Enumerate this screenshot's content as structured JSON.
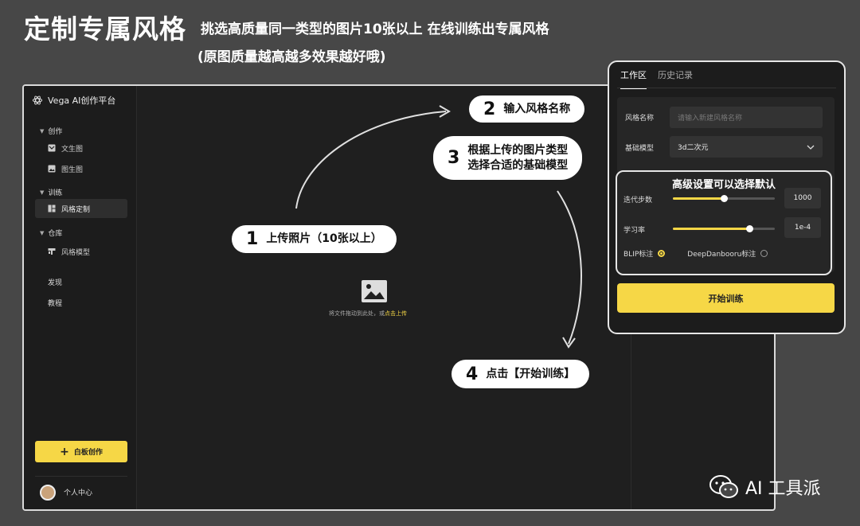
{
  "banner": {
    "title": "定制专属风格",
    "subtitle": "挑选高质量同一类型的图片10张以上 在线训练出专属风格",
    "subtitle2": "(原图质量越高越多效果越好哦)"
  },
  "sidebar": {
    "app_name": "Vega AI创作平台",
    "group_create": "创作",
    "item_text2img": "文生图",
    "item_img2img": "图生图",
    "group_train": "训练",
    "item_style_custom": "风格定制",
    "group_repo": "仓库",
    "item_style_model": "风格模型",
    "discover": "发现",
    "tutorial": "教程",
    "whiteboard_label": "白板创作",
    "user_center": "个人中心"
  },
  "upload": {
    "hint": "将文件拖动到此处，或",
    "link": "点击上传"
  },
  "steps": [
    {
      "num": "1",
      "text": "上传照片（10张以上）"
    },
    {
      "num": "2",
      "text": "输入风格名称"
    },
    {
      "num": "3",
      "text_line1": "根据上传的图片类型",
      "text_line2": "选择合适的基础模型"
    },
    {
      "num": "4",
      "text": "点击【开始训练】"
    }
  ],
  "panel": {
    "tab_workspace": "工作区",
    "tab_history": "历史记录",
    "style_name_label": "风格名称",
    "style_name_placeholder": "请输入新建风格名称",
    "base_model_label": "基础模型",
    "base_model_value": "3d二次元",
    "advanced_title": "高级设置可以选择默认",
    "iterations_label": "迭代步数",
    "iterations_value": "1000",
    "iterations_fraction": 0.5,
    "lr_label": "学习率",
    "lr_value": "1e-4",
    "lr_fraction": 0.75,
    "radio_blip": "BLIP标注",
    "radio_deepdanbooru": "DeepDanbooru标注",
    "start_button": "开始训练"
  },
  "watermark": {
    "text": "AI 工具派"
  },
  "colors": {
    "accent": "#f6d746",
    "background": "#474747",
    "app_bg": "#1f1f1f"
  }
}
